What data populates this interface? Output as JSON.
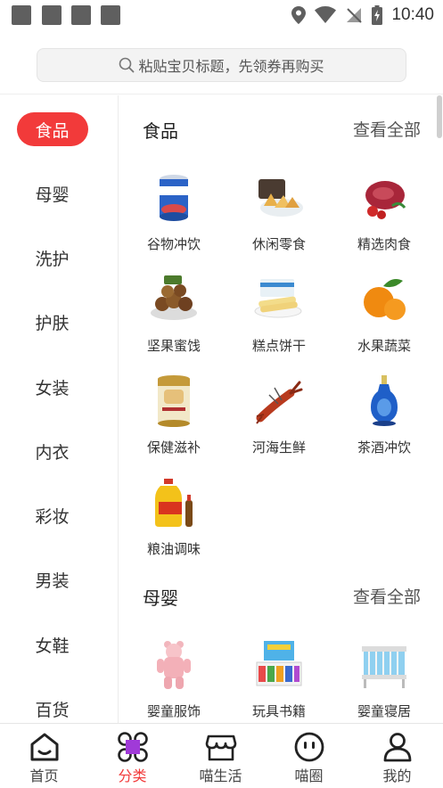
{
  "status_bar": {
    "time": "10:40"
  },
  "search": {
    "placeholder": "粘贴宝贝标题，先领券再购买"
  },
  "sidebar": {
    "items": [
      {
        "label": "食品",
        "active": true
      },
      {
        "label": "母婴"
      },
      {
        "label": "洗护"
      },
      {
        "label": "护肤"
      },
      {
        "label": "女装"
      },
      {
        "label": "内衣"
      },
      {
        "label": "彩妆"
      },
      {
        "label": "男装"
      },
      {
        "label": "女鞋"
      },
      {
        "label": "百货"
      }
    ]
  },
  "sections": [
    {
      "title": "食品",
      "more": "查看全部",
      "items": [
        {
          "label": "谷物冲饮",
          "icon": "cereal-can-icon"
        },
        {
          "label": "休闲零食",
          "icon": "snack-icon"
        },
        {
          "label": "精选肉食",
          "icon": "meat-icon"
        },
        {
          "label": "坚果蜜饯",
          "icon": "nuts-icon"
        },
        {
          "label": "糕点饼干",
          "icon": "pastry-icon"
        },
        {
          "label": "水果蔬菜",
          "icon": "orange-icon"
        },
        {
          "label": "保健滋补",
          "icon": "supplement-can-icon"
        },
        {
          "label": "河海生鲜",
          "icon": "crayfish-icon"
        },
        {
          "label": "茶酒冲饮",
          "icon": "liquor-bottle-icon"
        },
        {
          "label": "粮油调味",
          "icon": "oil-bottle-icon"
        }
      ]
    },
    {
      "title": "母婴",
      "more": "查看全部",
      "items": [
        {
          "label": "婴童服饰",
          "icon": "baby-clothes-icon"
        },
        {
          "label": "玩具书籍",
          "icon": "toy-books-icon"
        },
        {
          "label": "婴童寝居",
          "icon": "crib-icon"
        }
      ]
    }
  ],
  "tabbar": {
    "tabs": [
      {
        "label": "首页",
        "icon": "home-icon"
      },
      {
        "label": "分类",
        "icon": "category-icon",
        "active": true
      },
      {
        "label": "喵生活",
        "icon": "store-icon"
      },
      {
        "label": "喵圈",
        "icon": "smiley-icon"
      },
      {
        "label": "我的",
        "icon": "profile-icon"
      }
    ]
  },
  "colors": {
    "accent": "#f23a3a"
  }
}
